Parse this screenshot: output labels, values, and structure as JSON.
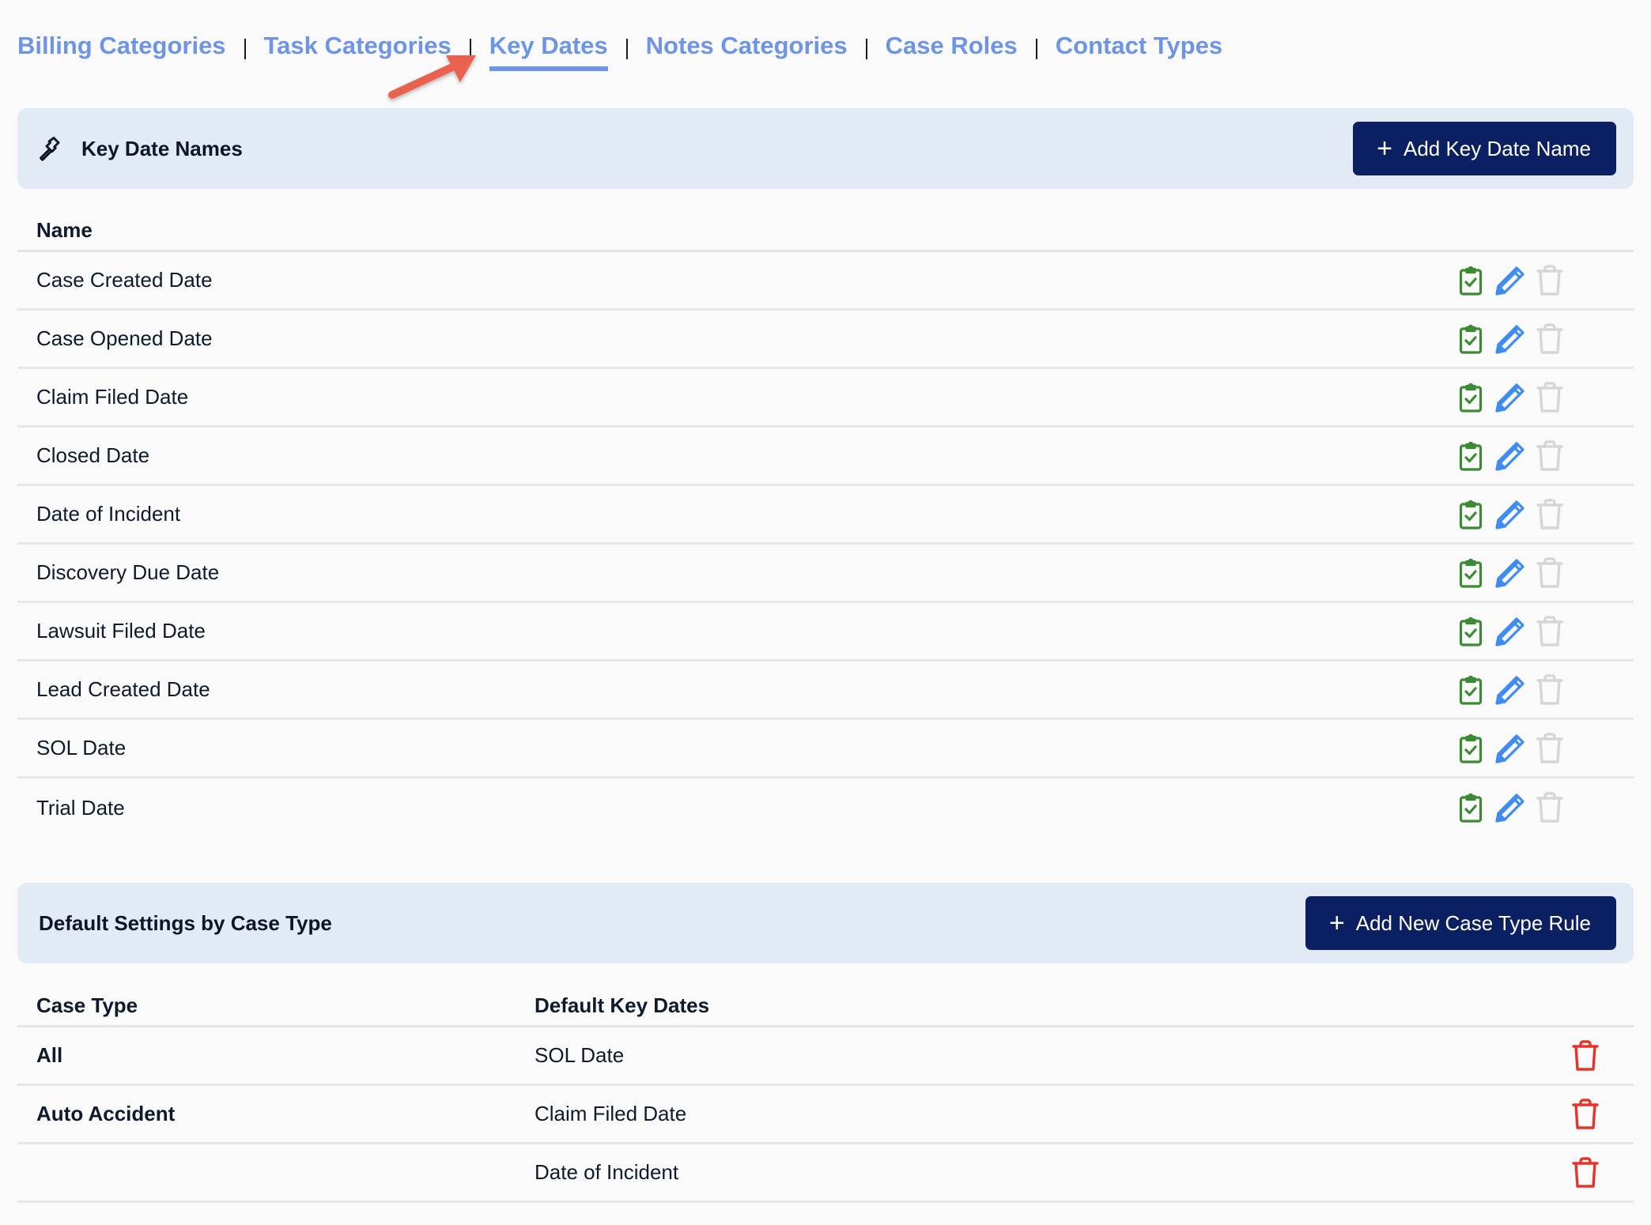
{
  "nav": {
    "links": [
      {
        "label": "Billing Categories",
        "active": false
      },
      {
        "label": "Task Categories",
        "active": false
      },
      {
        "label": "Key Dates",
        "active": true
      },
      {
        "label": "Notes Categories",
        "active": false
      },
      {
        "label": "Case Roles",
        "active": false
      },
      {
        "label": "Contact Types",
        "active": false
      }
    ],
    "separator": "|"
  },
  "colors": {
    "nav_link": "#6d94e5",
    "header_bg": "#e2eaf6",
    "primary_button": "#0b1f63",
    "annotation_arrow": "#e8624f",
    "clipboard_icon": "#3d8a35",
    "edit_icon": "#3f8cf0",
    "trash_disabled": "#d6d6d6",
    "trash_active": "#e5352b"
  },
  "key_dates": {
    "title": "Key Date Names",
    "title_icon": "gavel-icon",
    "add_button": {
      "icon": "plus-icon",
      "label": "Add Key Date Name"
    },
    "columns": {
      "name": "Name"
    },
    "rows": [
      {
        "name": "Case Created Date"
      },
      {
        "name": "Case Opened Date"
      },
      {
        "name": "Claim Filed Date"
      },
      {
        "name": "Closed Date"
      },
      {
        "name": "Date of Incident"
      },
      {
        "name": "Discovery Due Date"
      },
      {
        "name": "Lawsuit Filed Date"
      },
      {
        "name": "Lead Created Date"
      },
      {
        "name": "SOL Date"
      },
      {
        "name": "Trial Date"
      }
    ],
    "row_actions": [
      "clipboard-check-icon",
      "pencil-icon",
      "trash-icon-disabled"
    ]
  },
  "defaults": {
    "title": "Default Settings by Case Type",
    "add_button": {
      "icon": "plus-icon",
      "label": "Add New Case Type Rule"
    },
    "columns": {
      "case_type": "Case Type",
      "default_key_dates": "Default Key Dates"
    },
    "rows": [
      {
        "case_type": "All",
        "key_date": "SOL Date"
      },
      {
        "case_type": "Auto Accident",
        "key_date": "Claim Filed Date"
      },
      {
        "case_type": "",
        "key_date": "Date of Incident"
      }
    ],
    "row_actions": [
      "trash-icon"
    ]
  }
}
